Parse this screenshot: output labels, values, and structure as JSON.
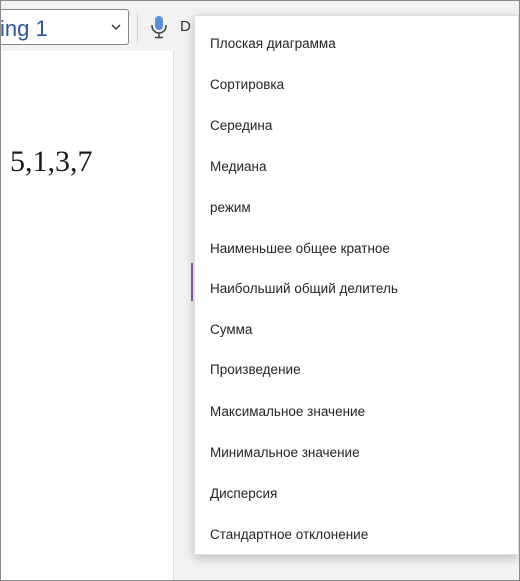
{
  "toolbar": {
    "style_select_value": "ing 1",
    "dictate_label": "D"
  },
  "document": {
    "numbers_text": "5,1,3,7"
  },
  "menu": {
    "items": [
      "Плоская диаграмма",
      "Сортировка",
      "Середина",
      "Медиана",
      "режим",
      "Наименьшее общее кратное",
      "Наибольший общий делитель",
      "Сумма",
      "Произведение",
      "Максимальное значение",
      "Минимальное значение",
      "Дисперсия",
      "Стандартное отклонение"
    ]
  },
  "colors": {
    "accent": "#2b579a",
    "marker": "#8a5fb0",
    "mic": "#5b8fd6"
  }
}
